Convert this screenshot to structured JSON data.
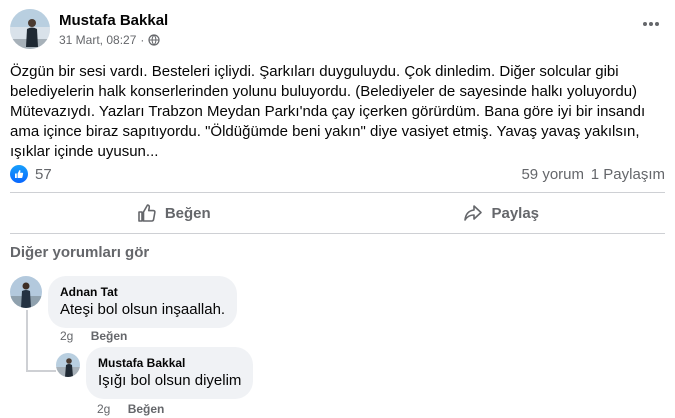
{
  "post": {
    "author": "Mustafa Bakkal",
    "date": "31 Mart, 08:27",
    "separator": "·",
    "text": "Özgün bir sesi vardı. Besteleri içliydi. Şarkıları duyguluydu. Çok dinledim. Diğer solcular gibi belediyelerin halk konserlerinden yolunu buluyordu. (Belediyeler de sayesinde halkı yoluyordu) Mütevazıydı. Yazları Trabzon Meydan Parkı'nda çay içerken görürdüm. Bana göre iyi bir insandı ama içince biraz sapıtıyordu. \"Öldüğümde beni yakın\" diye vasiyet etmiş. Yavaş yavaş yakılsın, ışıklar içinde uyusun...",
    "reaction_count": "57",
    "comment_count": "59 yorum",
    "share_count": "1 Paylaşım",
    "icons": {
      "privacy": "globe-icon",
      "more": "more-horizontal-icon",
      "reaction": "like-reaction-icon"
    }
  },
  "actions": {
    "like_label": "Beğen",
    "share_label": "Paylaş"
  },
  "comments": {
    "more_label": "Diğer yorumları gör",
    "items": [
      {
        "author": "Adnan Tat",
        "text": "Ateşi bol olsun inşaallah.",
        "time": "2g",
        "like_label": "Beğen"
      },
      {
        "author": "Mustafa Bakkal",
        "text": "Işığı bol olsun diyelim",
        "time": "2g",
        "like_label": "Beğen"
      }
    ]
  },
  "colors": {
    "accent": "#0866ff",
    "secondary_text": "#65676b",
    "bubble": "#f0f2f5",
    "divider": "#ced0d4"
  }
}
